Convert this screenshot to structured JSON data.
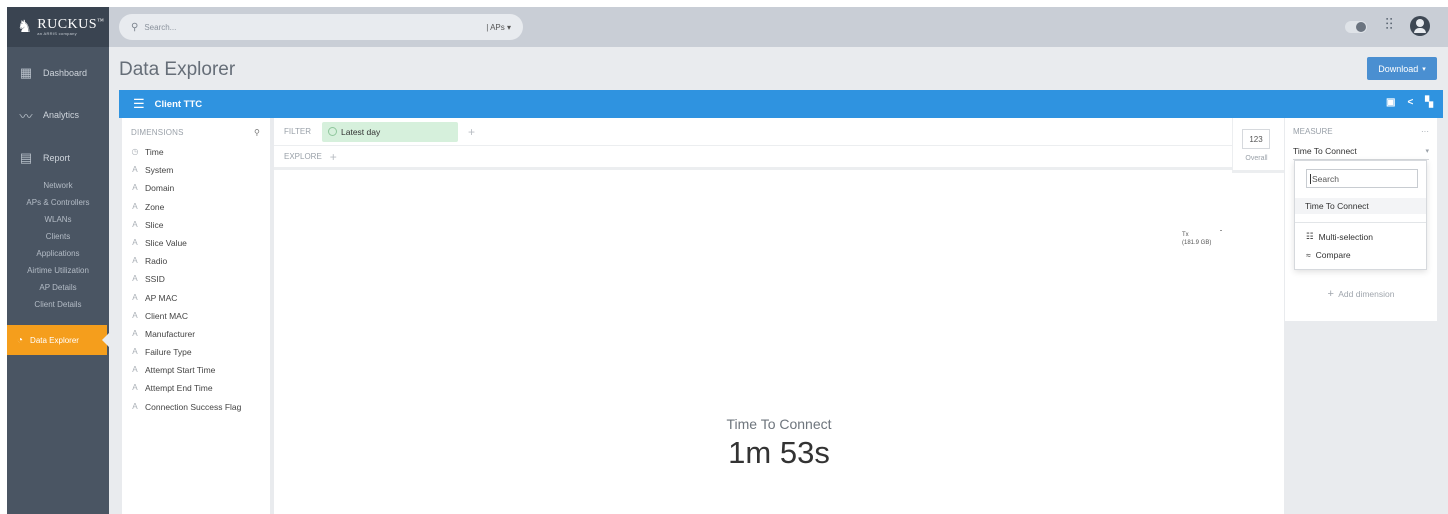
{
  "brand": {
    "name": "RUCKUS",
    "tagline": "an ARRIS company",
    "tm": "™"
  },
  "sidebar": {
    "dashboard": "Dashboard",
    "analytics": "Analytics",
    "report": "Report",
    "report_items": [
      "Network",
      "APs & Controllers",
      "WLANs",
      "Clients",
      "Applications",
      "Airtime Utilization",
      "AP Details",
      "Client Details"
    ],
    "data_explorer": "Data Explorer"
  },
  "topbar": {
    "search_placeholder": "Search...",
    "scope": "| APs ▾"
  },
  "page": {
    "title": "Data Explorer",
    "download_label": "Download",
    "panel_title": "Client TTC"
  },
  "dimensions": {
    "header": "DIMENSIONS",
    "items": [
      {
        "glyph": "◷",
        "label": "Time"
      },
      {
        "glyph": "Ａ",
        "label": "System"
      },
      {
        "glyph": "Ａ",
        "label": "Domain"
      },
      {
        "glyph": "Ａ",
        "label": "Zone"
      },
      {
        "glyph": "Ａ",
        "label": "Slice"
      },
      {
        "glyph": "Ａ",
        "label": "Slice Value"
      },
      {
        "glyph": "Ａ",
        "label": "Radio"
      },
      {
        "glyph": "Ａ",
        "label": "SSID"
      },
      {
        "glyph": "Ａ",
        "label": "AP MAC"
      },
      {
        "glyph": "Ａ",
        "label": "Client MAC"
      },
      {
        "glyph": "Ａ",
        "label": "Manufacturer"
      },
      {
        "glyph": "Ａ",
        "label": "Failure Type"
      },
      {
        "glyph": "Ａ",
        "label": "Attempt Start Time"
      },
      {
        "glyph": "Ａ",
        "label": "Attempt End Time"
      },
      {
        "glyph": "Ａ",
        "label": "Connection Success Flag"
      }
    ]
  },
  "filter": {
    "label": "FILTER",
    "pill": "Latest day"
  },
  "explore": {
    "label": "EXPLORE"
  },
  "overall": {
    "value": "123",
    "label": "Overall"
  },
  "legend": {
    "line1": "Tx",
    "line2": "(181.9 GB)"
  },
  "metric": {
    "title": "Time To Connect",
    "value": "1m 53s"
  },
  "measure": {
    "header": "MEASURE",
    "more": "···",
    "selected": "Time To Connect",
    "add_dimension": "Add dimension"
  },
  "dropdown": {
    "search_value": "Search",
    "option": "Time To Connect",
    "multi_selection": "Multi-selection",
    "compare": "Compare"
  },
  "colors": {
    "sidebar_bg": "#4a5563",
    "accent_orange": "#f59e1c",
    "panel_blue": "#2f93e0",
    "download_blue": "#4a8fd1",
    "filter_green": "#d6f0dc"
  },
  "icons": [
    "search-icon",
    "caret-down-icon",
    "toggle-switch",
    "sliders-icon",
    "user-icon",
    "hamburger-icon",
    "save-icon",
    "share-icon",
    "fullscreen-icon",
    "clock-icon",
    "string-dimension-icon",
    "plus-icon",
    "list-icon",
    "compare-icon"
  ]
}
